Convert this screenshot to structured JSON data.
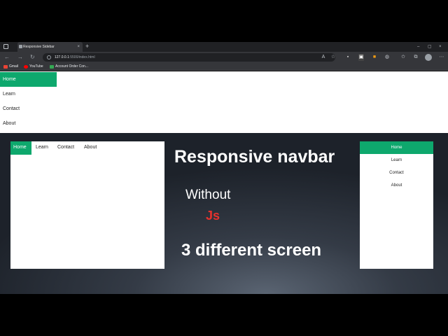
{
  "browser": {
    "tab_title": "Responsive Sidebar",
    "tab_close": "×",
    "new_tab": "+",
    "window_controls": [
      "–",
      "▢",
      "×"
    ],
    "url_host": "127.0.0.1",
    "url_path": ":5500/index.html",
    "bookmarks": [
      {
        "label": "Gmail",
        "color": "#ea4335"
      },
      {
        "label": "YouTube",
        "color": "#ff0000"
      },
      {
        "label": "Account Order Con...",
        "color": "#34a853"
      }
    ]
  },
  "sidebar": {
    "items": [
      "Home",
      "Learn",
      "Contact",
      "About"
    ],
    "active": "Home"
  },
  "tablet": {
    "items": [
      "Home",
      "Learn",
      "Contact",
      "About"
    ]
  },
  "mobile": {
    "items": [
      "Home",
      "Learn",
      "Contact",
      "About"
    ]
  },
  "overlay": {
    "heading": "Responsive navbar",
    "without": "Without",
    "js": "Js",
    "screens": "3 different screen"
  },
  "colors": {
    "accent": "#0ea86d",
    "js_red": "#e5322d"
  }
}
